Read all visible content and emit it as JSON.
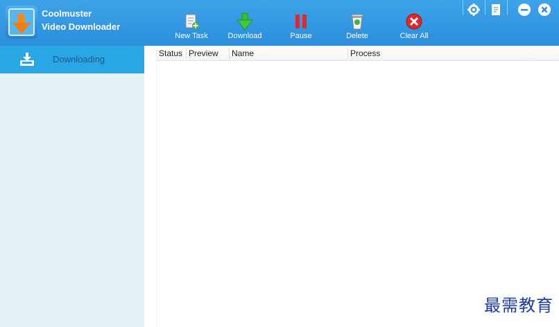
{
  "app": {
    "title_line1": "Coolmuster",
    "title_line2": "Video Downloader"
  },
  "toolbar": [
    {
      "id": "new-task",
      "label": "New Task",
      "icon": "new-task-icon"
    },
    {
      "id": "download",
      "label": "Download",
      "icon": "download-icon"
    },
    {
      "id": "pause",
      "label": "Pause",
      "icon": "pause-icon"
    },
    {
      "id": "delete",
      "label": "Delete",
      "icon": "delete-icon"
    },
    {
      "id": "clear-all",
      "label": "Clear All",
      "icon": "clear-all-icon"
    }
  ],
  "window_controls": [
    "settings-icon",
    "feedback-icon",
    "minimize-icon",
    "close-icon"
  ],
  "sidebar": {
    "items": [
      {
        "label": "Downloading",
        "icon": "download-tray-icon",
        "selected": true
      }
    ]
  },
  "list": {
    "columns": [
      "Status",
      "Preview",
      "Name",
      "Process"
    ],
    "rows": []
  },
  "watermark": "最需教育",
  "colors": {
    "header": "#2a8edc",
    "sidebar": "#e4f1f7",
    "sidebar_selected": "#29a6e4",
    "sidebar_text": "#1b5a86"
  }
}
